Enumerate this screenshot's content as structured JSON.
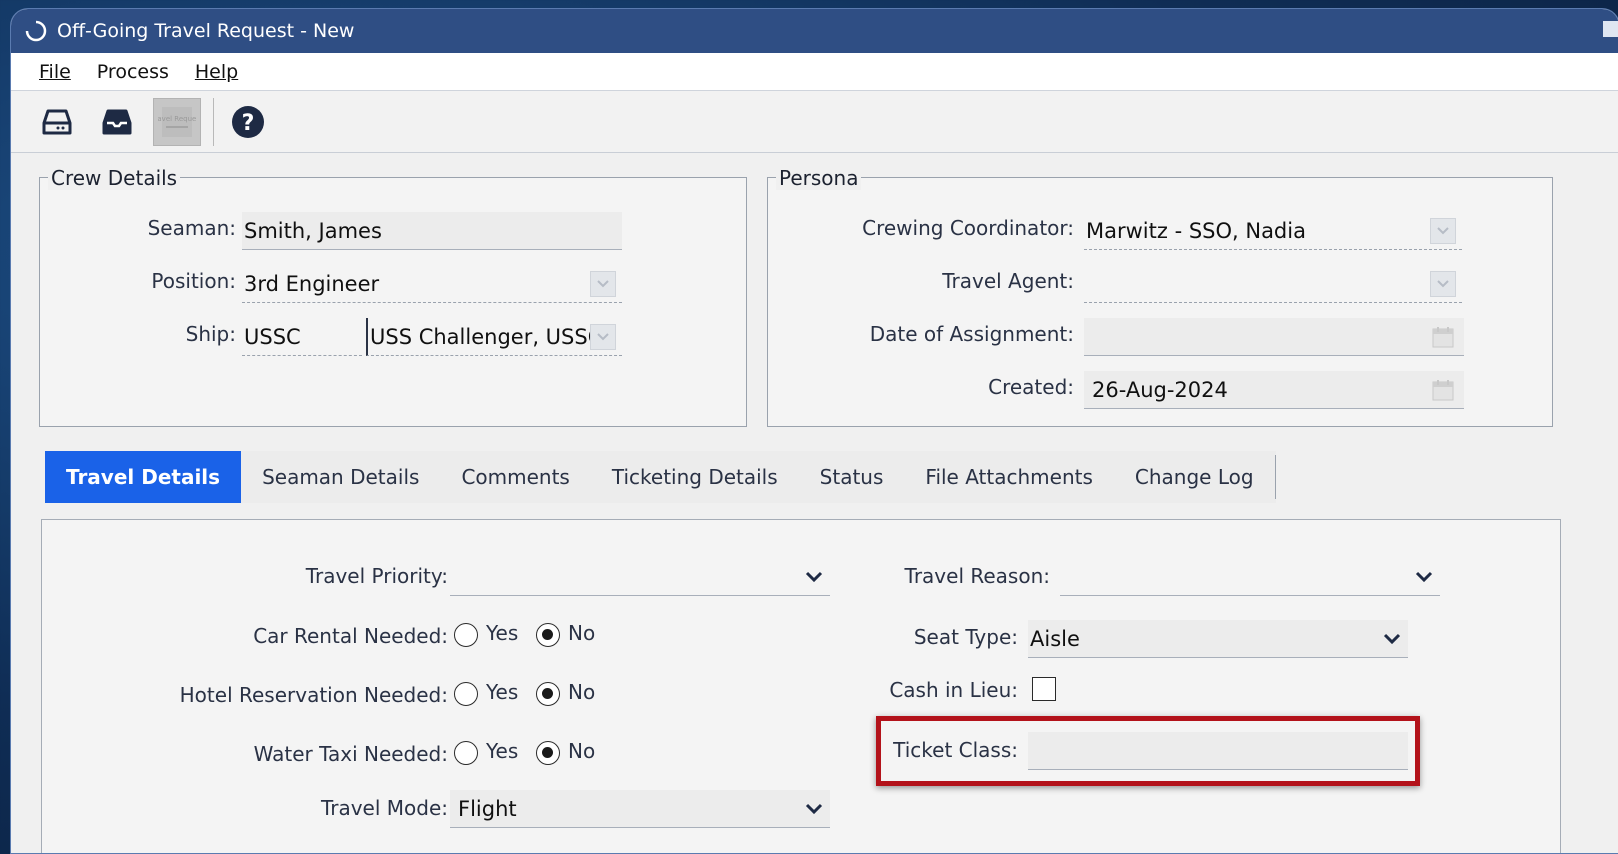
{
  "window": {
    "title": "Off-Going Travel Request - New"
  },
  "menu": {
    "file": "File",
    "process": "Process",
    "help": "Help"
  },
  "toolbar": {
    "disabled_button_text": "Travel Request"
  },
  "crew_details": {
    "legend": "Crew Details",
    "seaman_label": "Seaman:",
    "seaman_value": "Smith, James",
    "position_label": "Position:",
    "position_value": "3rd Engineer",
    "ship_label": "Ship:",
    "ship_code": "USSC",
    "ship_name": "USS Challenger, USSC"
  },
  "persona": {
    "legend": "Persona",
    "coordinator_label": "Crewing Coordinator:",
    "coordinator_value": "Marwitz - SSO, Nadia",
    "agent_label": "Travel Agent:",
    "agent_value": "",
    "assignment_label": "Date of Assignment:",
    "assignment_value": "",
    "created_label": "Created:",
    "created_value": "26-Aug-2024"
  },
  "tabs": [
    "Travel Details",
    "Seaman Details",
    "Comments",
    "Ticketing Details",
    "Status",
    "File Attachments",
    "Change Log"
  ],
  "travel_details": {
    "priority_label": "Travel Priority:",
    "priority_value": "",
    "car_label": "Car Rental Needed:",
    "hotel_label": "Hotel Reservation Needed:",
    "taxi_label": "Water Taxi Needed:",
    "yes": "Yes",
    "no": "No",
    "car_selected": "No",
    "hotel_selected": "No",
    "taxi_selected": "No",
    "mode_label": "Travel Mode:",
    "mode_value": "Flight",
    "reason_label": "Travel Reason:",
    "reason_value": "",
    "seat_label": "Seat Type:",
    "seat_value": "Aisle",
    "cash_label": "Cash in Lieu:",
    "cash_checked": false,
    "ticket_label": "Ticket Class:",
    "ticket_value": ""
  },
  "colors": {
    "titlebar": "#2f4e84",
    "active_tab": "#1a62e8",
    "highlight": "#b3121a"
  }
}
